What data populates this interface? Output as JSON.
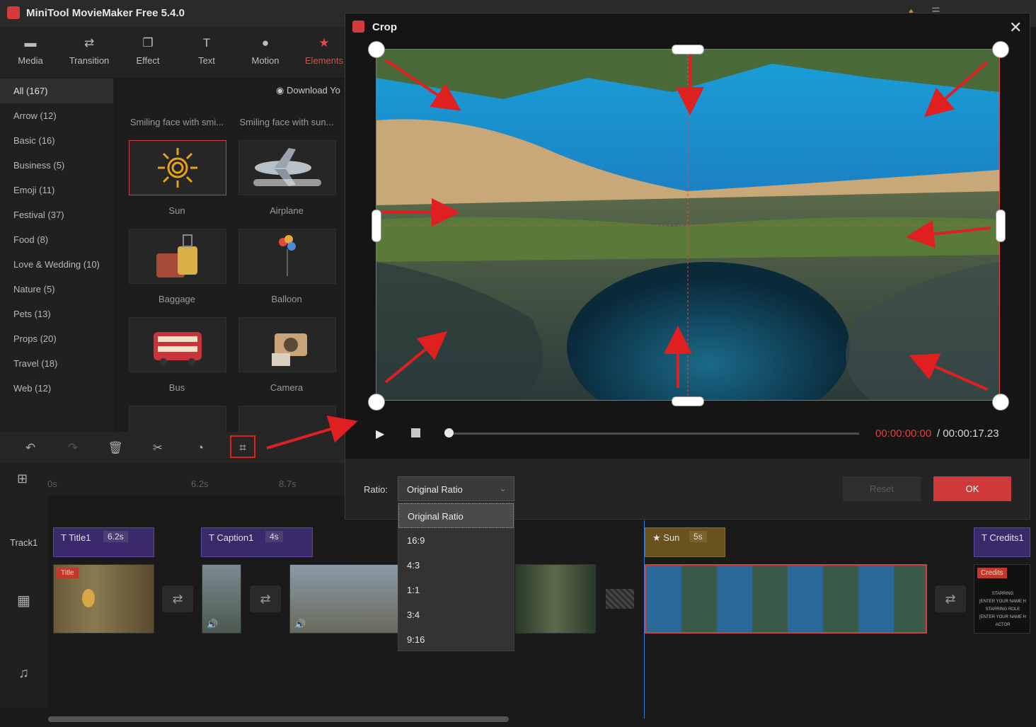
{
  "app": {
    "title": "MiniTool MovieMaker Free 5.4.0"
  },
  "toolbar": {
    "items": [
      {
        "label": "Media",
        "icon": "folder-icon"
      },
      {
        "label": "Transition",
        "icon": "swap-icon"
      },
      {
        "label": "Effect",
        "icon": "layers-icon"
      },
      {
        "label": "Text",
        "icon": "text-icon"
      },
      {
        "label": "Motion",
        "icon": "motion-icon"
      },
      {
        "label": "Elements",
        "icon": "elements-icon",
        "active": true
      }
    ]
  },
  "categories": [
    "All (167)",
    "Arrow (12)",
    "Basic (16)",
    "Business (5)",
    "Emoji (11)",
    "Festival (37)",
    "Food (8)",
    "Love & Wedding (10)",
    "Nature (5)",
    "Pets (13)",
    "Props (20)",
    "Travel (18)",
    "Web (12)"
  ],
  "grid": {
    "download_label": "Download Yo",
    "top_captions": [
      "Smiling face with smi...",
      "Smiling face with sun..."
    ],
    "items": [
      {
        "label": "Sun",
        "icon": "sun-icon",
        "selected": true
      },
      {
        "label": "Airplane",
        "icon": "airplane-icon"
      },
      {
        "label": "Baggage",
        "icon": "baggage-icon"
      },
      {
        "label": "Balloon",
        "icon": "balloon-icon"
      },
      {
        "label": "Bus",
        "icon": "bus-icon"
      },
      {
        "label": "Camera",
        "icon": "camera-icon"
      }
    ]
  },
  "ruler": {
    "ticks": [
      "0s",
      "6.2s",
      "8.7s"
    ]
  },
  "timeline": {
    "track1_label": "Track1",
    "text_clips": [
      {
        "name": "Title1",
        "duration": "6.2s"
      },
      {
        "name": "Caption1",
        "duration": "4s"
      },
      {
        "name": "Sun",
        "duration": "5s"
      },
      {
        "name": "Credits1",
        "duration": ""
      }
    ],
    "title_badge": "Title",
    "credits_badge": "Credits",
    "credits_lines": [
      "STARRING",
      "[ENTER YOUR NAME H",
      "STARRING ROLE",
      "[ENTER YOUR NAME H",
      "ACTOR"
    ]
  },
  "crop": {
    "title": "Crop",
    "time_current": "00:00:00:00",
    "time_total": "/ 00:00:17.23",
    "ratio_label": "Ratio:",
    "ratio_selected": "Original Ratio",
    "ratio_options": [
      "Original Ratio",
      "16:9",
      "4:3",
      "1:1",
      "3:4",
      "9:16"
    ],
    "reset_label": "Reset",
    "ok_label": "OK"
  },
  "colors": {
    "accent": "#d0393a",
    "annotation": "#e02020",
    "playhead": "#3a7bd5"
  }
}
